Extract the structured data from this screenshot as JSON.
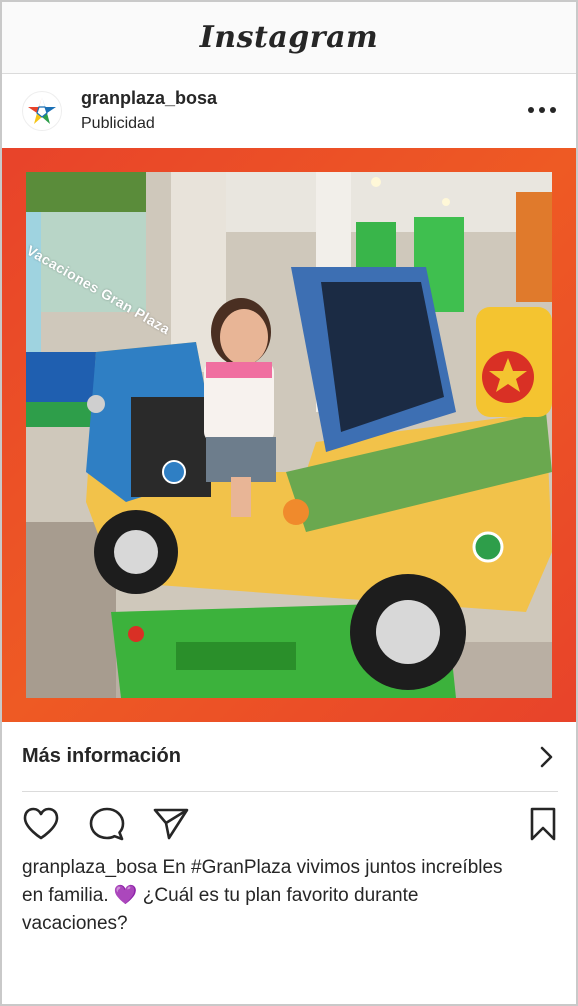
{
  "app": {
    "title": "Instagram"
  },
  "post": {
    "username": "granplaza_bosa",
    "label": "Publicidad",
    "media_overlay_text": "Vacaciones Gran Plaza",
    "cta_label": "Más información",
    "caption_user": "granplaza_bosa",
    "caption_text": "En #GranPlaza vivimos juntos increíbles en familia. 💜 ¿Cuál es tu plan favorito durante vacaciones?"
  },
  "icons": {
    "avatar": "star-logo-icon",
    "more": "more-options-icon",
    "like": "heart-icon",
    "comment": "comment-icon",
    "share": "paper-plane-icon",
    "save": "bookmark-icon",
    "cta": "chevron-right-icon"
  },
  "colors": {
    "media_frame": "#e8432a",
    "text": "#262626",
    "divider": "#dbdbdb"
  }
}
